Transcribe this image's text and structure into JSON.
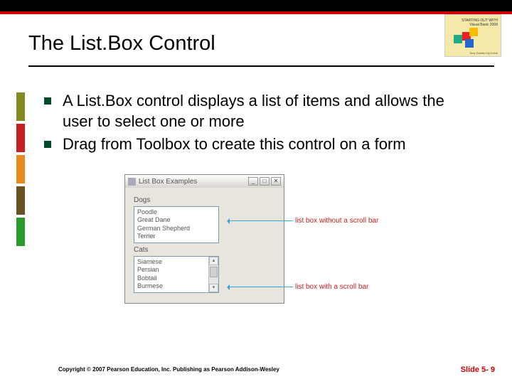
{
  "header": {
    "title": "The List.Box Control",
    "logo": {
      "line1": "STARTING OUT WITH",
      "line2": "Visual Basic",
      "line3": "2008",
      "footer": "Tony Gaddis   Kip Irvine"
    }
  },
  "bullets": [
    "A List.Box control displays a list of items and allows the user to select one or more",
    "Drag from Toolbox to create this control on a form"
  ],
  "window": {
    "title": "List Box Examples",
    "section1_label": "Dogs",
    "list1": [
      "Poodle",
      "Great Dane",
      "German Shepherd",
      "Terrier"
    ],
    "section2_label": "Cats",
    "list2": [
      "Siamese",
      "Persian",
      "Bobtail",
      "Burmese"
    ]
  },
  "annotations": {
    "a1": "list box without a scroll bar",
    "a2": "list box with a scroll bar"
  },
  "footer": {
    "copyright": "Copyright © 2007 Pearson Education, Inc. Publishing as Pearson Addison-Wesley",
    "slide": "Slide 5- 9"
  }
}
